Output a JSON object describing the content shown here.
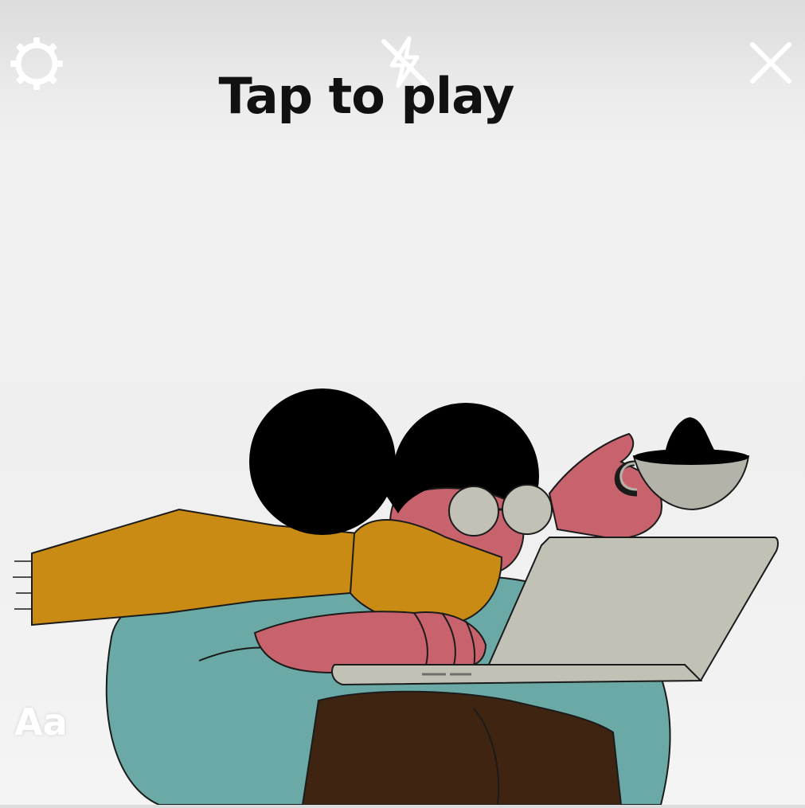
{
  "header": {
    "title": "Tap to play"
  },
  "icons": {
    "settings": "gear-icon",
    "flash": "flash-off-icon",
    "close": "close-icon"
  },
  "footer": {
    "text_tool_label": "Aa"
  },
  "colors": {
    "icon_white": "#ffffff",
    "title": "#111111",
    "skin": "#c8626c",
    "scarf": "#c98b13",
    "sweater": "#6aa9a5",
    "pants": "#3f2411",
    "laptop": "#c2c1b6",
    "cup": "#b4b3aa",
    "hair": "#000000"
  }
}
